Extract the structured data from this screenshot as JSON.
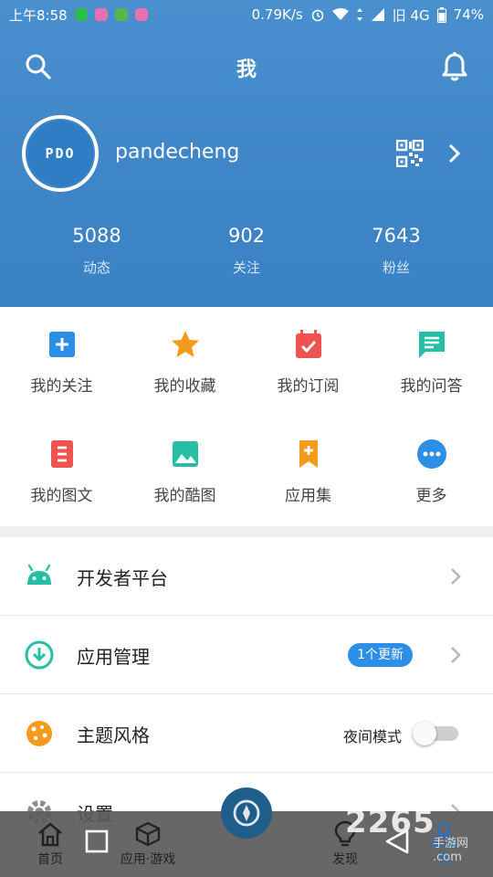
{
  "status_bar": {
    "time": "上午8:58",
    "network_speed": "0.79K/s",
    "carrier": "旧 4G",
    "battery": "74%"
  },
  "header": {
    "title": "我"
  },
  "profile": {
    "avatar_text": "PDO",
    "username": "pandecheng"
  },
  "stats": [
    {
      "value": "5088",
      "label": "动态"
    },
    {
      "value": "902",
      "label": "关注"
    },
    {
      "value": "7643",
      "label": "粉丝"
    }
  ],
  "grid": [
    {
      "label": "我的关注",
      "icon": "add-box-icon",
      "color": "#2d8ee6"
    },
    {
      "label": "我的收藏",
      "icon": "star-icon",
      "color": "#f59b1b"
    },
    {
      "label": "我的订阅",
      "icon": "calendar-check-icon",
      "color": "#ef5350"
    },
    {
      "label": "我的问答",
      "icon": "chat-icon",
      "color": "#26bfa5"
    },
    {
      "label": "我的图文",
      "icon": "document-icon",
      "color": "#ef5350"
    },
    {
      "label": "我的酷图",
      "icon": "image-icon",
      "color": "#26bfa5"
    },
    {
      "label": "应用集",
      "icon": "bookmark-plus-icon",
      "color": "#f59b1b"
    },
    {
      "label": "更多",
      "icon": "more-icon",
      "color": "#2d8ee6"
    }
  ],
  "menu": {
    "developer": "开发者平台",
    "app_manage": "应用管理",
    "update_badge": "1个更新",
    "theme": "主题风格",
    "night_mode": "夜间模式",
    "night_mode_on": false,
    "settings": "设置"
  },
  "bottom_nav": {
    "home": "首页",
    "apps": "应用·游戏",
    "discover": "发现",
    "me": "我"
  },
  "watermark": {
    "main": "2265",
    "sub": "手游网",
    "sub2": ".com"
  },
  "colors": {
    "header_blue": "#3f86c8",
    "accent_blue": "#2d8ee6",
    "android_green": "#26bfa5",
    "cookie_orange": "#f59b1b"
  }
}
